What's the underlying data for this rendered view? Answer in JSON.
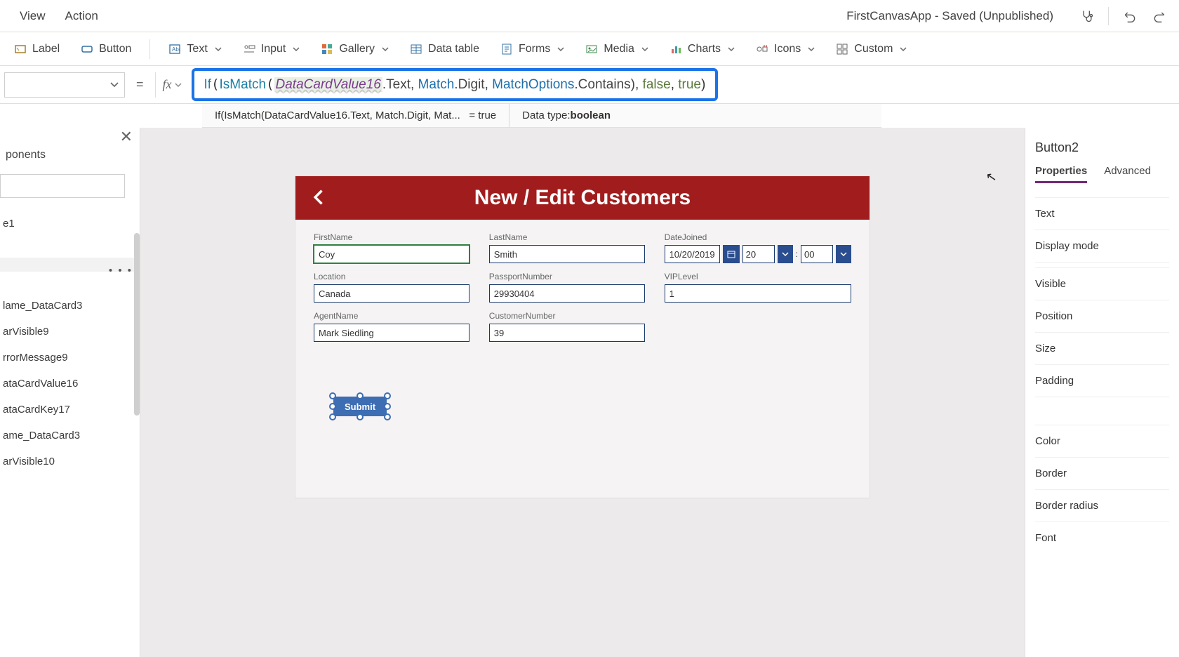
{
  "menubar": {
    "items": [
      "View",
      "Action"
    ],
    "app_title": "FirstCanvasApp - Saved (Unpublished)"
  },
  "ribbon": {
    "label": "Label",
    "button": "Button",
    "text": "Text",
    "input": "Input",
    "gallery": "Gallery",
    "datatable": "Data table",
    "forms": "Forms",
    "media": "Media",
    "charts": "Charts",
    "icons": "Icons",
    "custom": "Custom"
  },
  "formula": {
    "kw_if": "If",
    "kw_ismatch": "IsMatch",
    "ref": "DataCardValue16",
    "prop": ".Text, ",
    "cls_match": "Match",
    "prop2": ".Digit, ",
    "cls_opts": "MatchOptions",
    "prop3": ".Contains), ",
    "false": "false",
    "comma": ", ",
    "true": "true",
    "close": ")",
    "result_expr": "If(IsMatch(DataCardValue16.Text, Match.Digit, Mat...",
    "result_eq": "=  true",
    "datatype_label": "Data type: ",
    "datatype_value": "boolean"
  },
  "left": {
    "tab": "ponents",
    "tree_item_1": "e1",
    "tree_items": [
      "lame_DataCard3",
      "arVisible9",
      "rrorMessage9",
      "ataCardValue16",
      "ataCardKey17",
      "ame_DataCard3",
      "arVisible10"
    ]
  },
  "canvas": {
    "title": "New / Edit Customers",
    "fields": {
      "firstname": {
        "label": "FirstName",
        "value": "Coy"
      },
      "lastname": {
        "label": "LastName",
        "value": "Smith"
      },
      "datejoined": {
        "label": "DateJoined",
        "value": "10/20/2019",
        "hh": "20",
        "mm": "00"
      },
      "location": {
        "label": "Location",
        "value": "Canada"
      },
      "passport": {
        "label": "PassportNumber",
        "value": "29930404"
      },
      "vip": {
        "label": "VIPLevel",
        "value": "1"
      },
      "agent": {
        "label": "AgentName",
        "value": "Mark Siedling"
      },
      "custnum": {
        "label": "CustomerNumber",
        "value": "39"
      }
    },
    "submit": "Submit"
  },
  "right": {
    "title": "Button2",
    "tabs": {
      "properties": "Properties",
      "advanced": "Advanced"
    },
    "props": [
      "Text",
      "Display mode",
      "Visible",
      "Position",
      "Size",
      "Padding",
      "Color",
      "Border",
      "Border radius",
      "Font"
    ]
  }
}
